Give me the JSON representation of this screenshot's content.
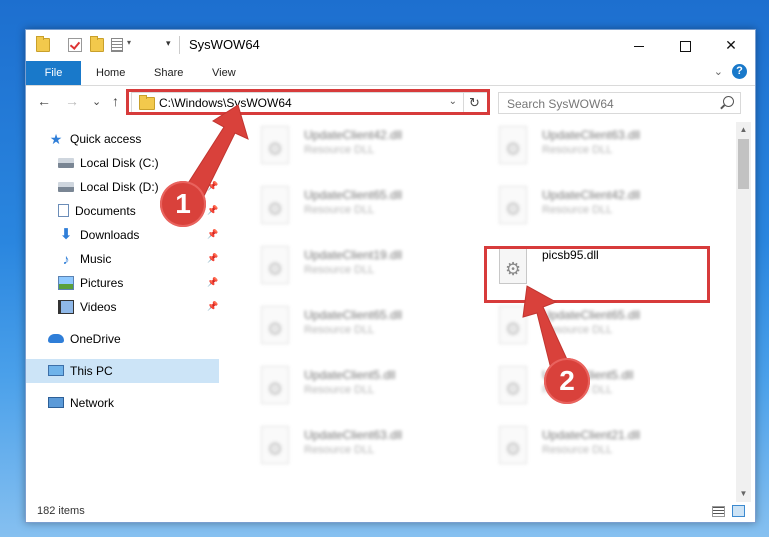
{
  "window": {
    "title": "SysWOW64",
    "quick_access_dropdown": "▾",
    "controls": {
      "minimize": "",
      "maximize": "",
      "close": "✕"
    }
  },
  "ribbon": {
    "tabs": [
      "File",
      "Home",
      "Share",
      "View"
    ],
    "collapse_chevron": "⌄",
    "help": "?"
  },
  "navigation": {
    "back": "←",
    "forward": "→",
    "recent": "⌄",
    "up": "↑"
  },
  "address": {
    "path": "C:\\Windows\\SysWOW64",
    "dropdown": "⌄",
    "refresh": "↻"
  },
  "search": {
    "placeholder": "Search SysWOW64"
  },
  "nav_pane": {
    "quick_access": "Quick access",
    "items": [
      {
        "label": "Local Disk (C:)",
        "icon": "drive-icon",
        "pinned": false
      },
      {
        "label": "Local Disk (D:)",
        "icon": "drive-icon",
        "pinned": true
      },
      {
        "label": "Documents",
        "icon": "documents-icon",
        "pinned": true
      },
      {
        "label": "Downloads",
        "icon": "downloads-icon",
        "pinned": true
      },
      {
        "label": "Music",
        "icon": "music-icon",
        "pinned": true
      },
      {
        "label": "Pictures",
        "icon": "pictures-icon",
        "pinned": true
      },
      {
        "label": "Videos",
        "icon": "videos-icon",
        "pinned": true
      }
    ],
    "onedrive": "OneDrive",
    "this_pc": "This PC",
    "network": "Network",
    "pin_glyph": "📌"
  },
  "files": [
    {
      "name": "UpdateClient42.dll",
      "type": "Resource DLL",
      "blurred": true
    },
    {
      "name": "UpdateClient63.dll",
      "type": "Resource DLL",
      "blurred": true
    },
    {
      "name": "UpdateClient65.dll",
      "type": "Resource DLL",
      "blurred": true
    },
    {
      "name": "UpdateClient42.dll",
      "type": "Resource DLL",
      "blurred": true
    },
    {
      "name": "UpdateClient19.dll",
      "type": "Resource DLL",
      "blurred": true
    },
    {
      "name": "picsb95.dll",
      "type": "",
      "blurred": false
    },
    {
      "name": "UpdateClient65.dll",
      "type": "Resource DLL",
      "blurred": true
    },
    {
      "name": "UpdateClient65.dll",
      "type": "Resource DLL",
      "blurred": true
    },
    {
      "name": "UpdateClient5.dll",
      "type": "Resource DLL",
      "blurred": true
    },
    {
      "name": "UpdateClient5.dll",
      "type": "Resource DLL",
      "blurred": true
    },
    {
      "name": "UpdateClient63.dll",
      "type": "Resource DLL",
      "blurred": true
    },
    {
      "name": "UpdateClient21.dll",
      "type": "Resource DLL",
      "blurred": true
    }
  ],
  "status": {
    "item_count": "182 items"
  },
  "annotations": {
    "step1": "1",
    "step2": "2",
    "color": "#d73b3b"
  }
}
